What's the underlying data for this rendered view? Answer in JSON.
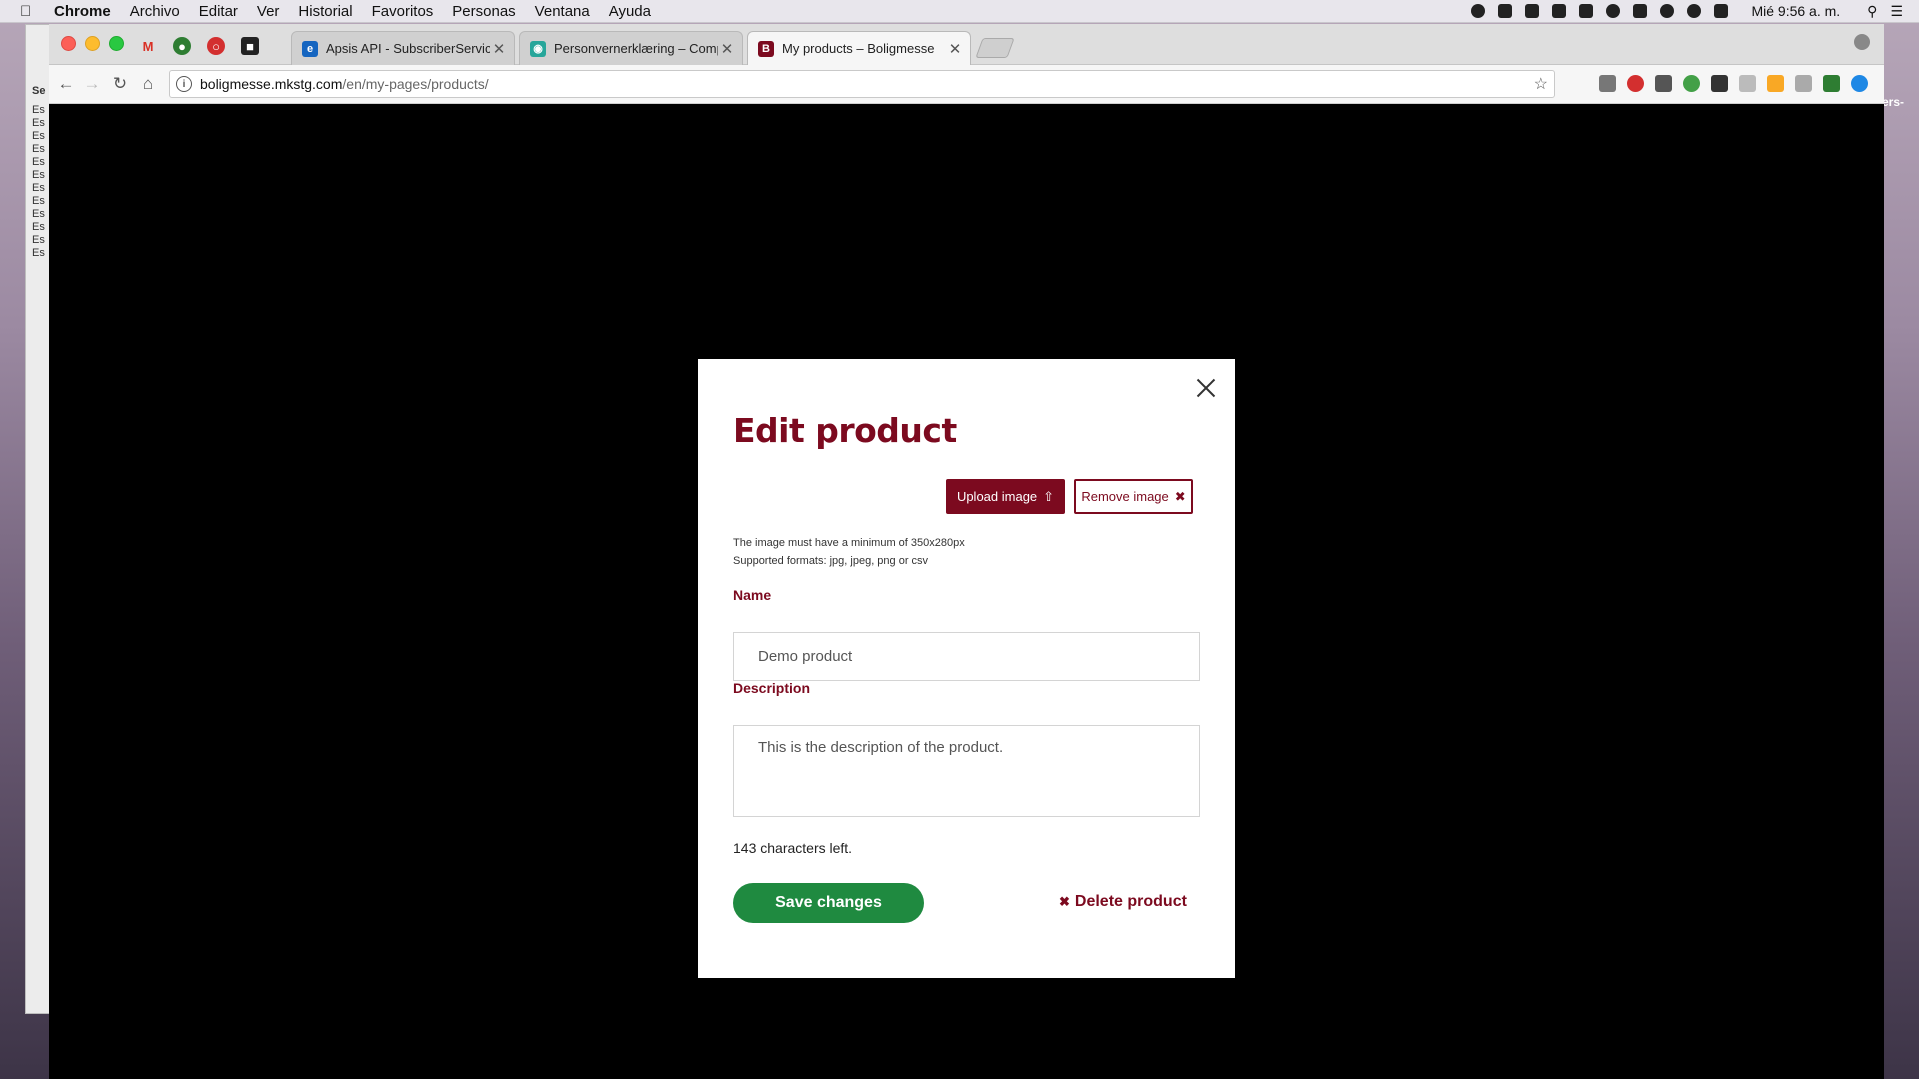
{
  "menubar": {
    "app": "Chrome",
    "items": [
      "Archivo",
      "Editar",
      "Ver",
      "Historial",
      "Favoritos",
      "Personas",
      "Ventana",
      "Ayuda"
    ],
    "clock": "Mié 9:56 a. m."
  },
  "background_window": {
    "rows": [
      "Se",
      "Es",
      "Es",
      "Es",
      "Es",
      "Es",
      "Es",
      "Es",
      "Es",
      "Es",
      "Es",
      "Es",
      "Es"
    ],
    "right_text": "ers-"
  },
  "browser": {
    "tabs": [
      {
        "title": "Apsis API - SubscriberService",
        "favicon": "apsis-icon"
      },
      {
        "title": "Personvernerklæring – Compa",
        "favicon": "cookie-icon"
      },
      {
        "title": "My products – Boligmesse",
        "favicon": "boligmesse-icon",
        "favicon_letter": "B"
      }
    ],
    "url_host": "boligmesse.mkstg.com",
    "url_path": "/en/my-pages/products/"
  },
  "modal": {
    "title": "Edit product",
    "upload_label": "Upload image",
    "remove_label": "Remove image",
    "hint_line1": "The image must have a minimum of 350x280px",
    "hint_line2": "Supported formats: jpg, jpeg, png or csv",
    "name_label": "Name",
    "name_value": "Demo product",
    "description_label": "Description",
    "description_value": "This is the description of the product.",
    "char_counter": "143 characters left.",
    "save_label": "Save changes",
    "delete_label": "Delete product"
  },
  "colors": {
    "brand": "#7c0a1f",
    "save": "#1f8a40"
  }
}
